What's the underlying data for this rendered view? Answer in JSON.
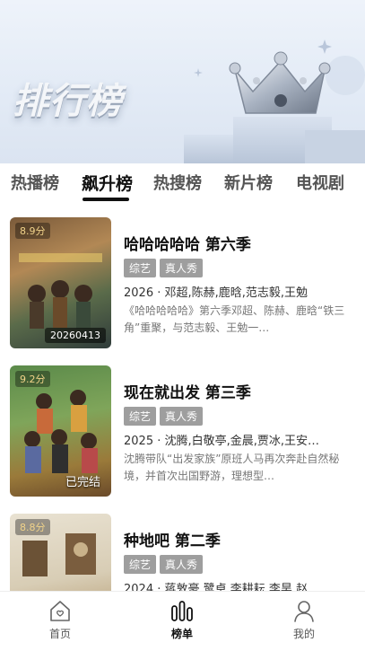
{
  "banner": {
    "title": "排行榜"
  },
  "tabs": [
    {
      "label": "热播榜"
    },
    {
      "label": "飙升榜",
      "active": true
    },
    {
      "label": "热搜榜"
    },
    {
      "label": "新片榜"
    },
    {
      "label": "电视剧"
    }
  ],
  "items": [
    {
      "score": "8.9分",
      "poster_tag": "20260413",
      "title": "哈哈哈哈哈 第六季",
      "chips": [
        "综艺",
        "真人秀"
      ],
      "meta": "2026 · 邓超,陈赫,鹿晗,范志毅,王勉",
      "desc": "《哈哈哈哈哈》第六季邓超、陈赫、鹿晗“铁三角”重聚，与范志毅、王勉一…"
    },
    {
      "score": "9.2分",
      "poster_tag": "已完结",
      "title": "现在就出发 第三季",
      "chips": [
        "综艺",
        "真人秀"
      ],
      "meta": "2025 · 沈腾,白敬亭,金晨,贾冰,王安…",
      "desc": "沈腾带队“出发家族”原班人马再次奔赴自然秘境，并首次出国野游，理想型…"
    },
    {
      "score": "8.8分",
      "poster_tag": "",
      "title": "种地吧 第二季",
      "chips": [
        "综艺",
        "真人秀"
      ],
      "meta": "2024 · 蒋敦豪,鹭卓,李耕耘,李昊,赵",
      "desc": ""
    }
  ],
  "nav": [
    {
      "label": "首页",
      "icon": "home-icon"
    },
    {
      "label": "榜单",
      "icon": "chart-icon",
      "active": true
    },
    {
      "label": "我的",
      "icon": "user-icon"
    }
  ]
}
